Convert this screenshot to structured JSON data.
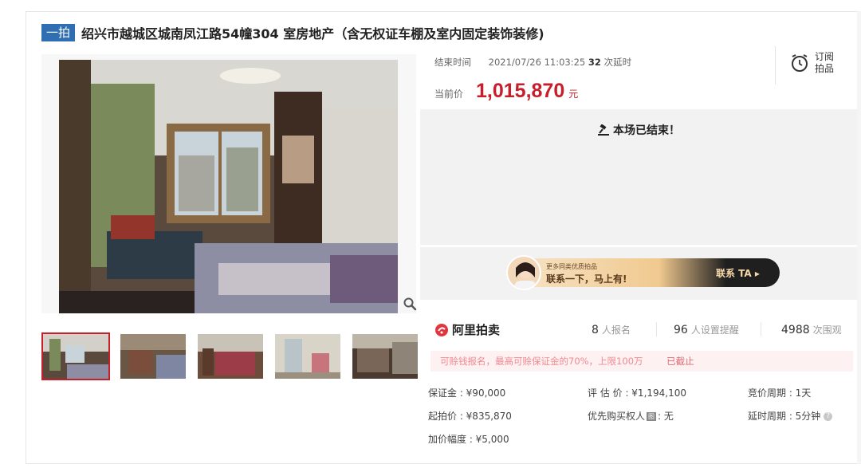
{
  "header": {
    "tag": "一拍",
    "title": "绍兴市越城区城南凤江路54幢304 室房地产（含无权证车棚及室内固定装饰装修)"
  },
  "auction": {
    "end_label": "结束时间",
    "end_time": "2021/07/26 11:03:25",
    "delay_count": "32",
    "delay_label": "次延时",
    "price_label": "当前价",
    "price": "1,015,870",
    "price_unit": "元",
    "ended_text": "本场已结束！"
  },
  "subscribe": {
    "line1": "订阅",
    "line2": "拍品"
  },
  "banner": {
    "small": "更多同类优质拍品",
    "big": "联系一下，马上有!",
    "button": "联系 TA ▸"
  },
  "brand": {
    "name": "阿里拍卖"
  },
  "stats": {
    "signup_count": "8",
    "signup_label": "人报名",
    "remind_count": "96",
    "remind_label": "人设置提醒",
    "view_count": "4988",
    "view_label": "次围观"
  },
  "notice": {
    "text": "可赊钱报名，最高可赊保证金的70%，上限100万",
    "status": "已截止"
  },
  "details": {
    "deposit": "保证金 : ¥90,000",
    "appraisal": "评 估 价 : ¥1,194,100",
    "cycle": "竞价周期 : 1天",
    "start_price": "起拍价 : ¥835,870",
    "priority_buyer_label": "优先购买权人",
    "priority_buyer_badge": "图",
    "priority_buyer_value": ": 无",
    "delay_cycle": "延时周期 : 5分钟",
    "increment": "加价幅度 : ¥5,000"
  },
  "icons": {
    "zoom": "search-icon",
    "subscribe": "alarm-clock-icon",
    "ended": "gavel-icon",
    "brand": "ali-auction-logo-icon",
    "help": "question-icon"
  },
  "colors": {
    "accent": "#c81e2a",
    "tag": "#2f6eb3",
    "notice_bg": "#fdf1f2"
  }
}
